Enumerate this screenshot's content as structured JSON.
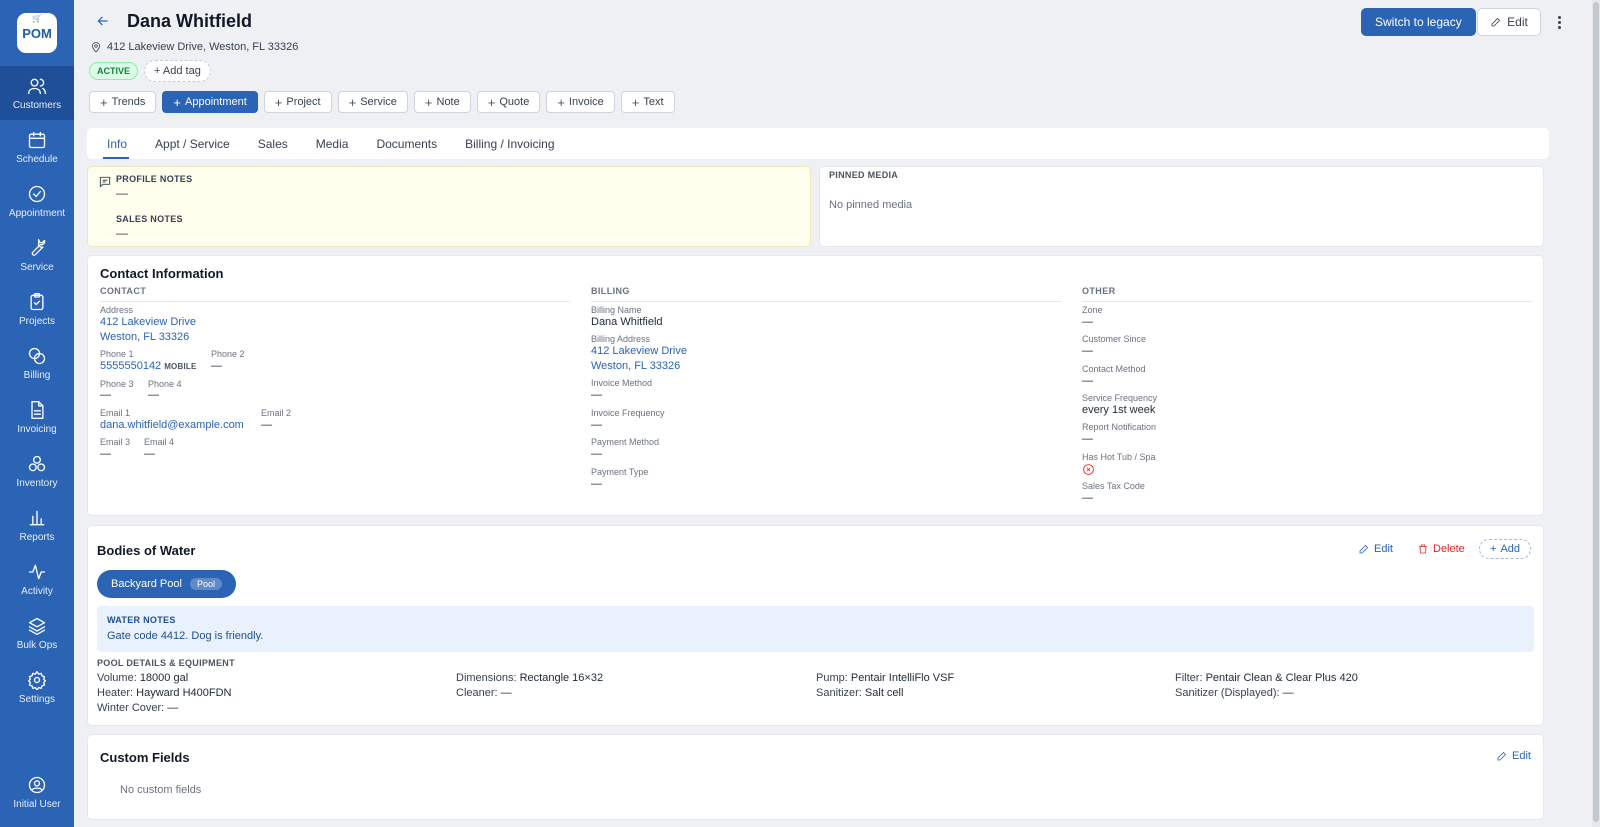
{
  "app": {
    "logo_text": "POM",
    "logo_icon": "cart-icon"
  },
  "sidebar": {
    "items": [
      {
        "label": "Customers",
        "icon": "users-icon",
        "active": true
      },
      {
        "label": "Schedule",
        "icon": "calendar-icon"
      },
      {
        "label": "Appointment",
        "icon": "check-circle-icon"
      },
      {
        "label": "Service",
        "icon": "wrench-icon"
      },
      {
        "label": "Projects",
        "icon": "clipboard-icon"
      },
      {
        "label": "Billing",
        "icon": "coins-icon"
      },
      {
        "label": "Invoicing",
        "icon": "document-icon"
      },
      {
        "label": "Inventory",
        "icon": "boxes-icon"
      },
      {
        "label": "Reports",
        "icon": "bar-chart-icon"
      },
      {
        "label": "Activity",
        "icon": "activity-icon"
      },
      {
        "label": "Bulk Ops",
        "icon": "layers-icon"
      },
      {
        "label": "Settings",
        "icon": "gear-icon"
      }
    ],
    "user": {
      "label": "Initial User",
      "icon": "user-circle-icon"
    }
  },
  "header": {
    "title": "Dana Whitfield",
    "address": "412 Lakeview Drive, Weston, FL 33326",
    "status": "ACTIVE",
    "add_tag": "+ Add tag",
    "switch_legacy": "Switch to legacy",
    "edit": "Edit"
  },
  "actions": [
    {
      "label": "Trends",
      "primary": false
    },
    {
      "label": "Appointment",
      "primary": true
    },
    {
      "label": "Project",
      "primary": false
    },
    {
      "label": "Service",
      "primary": false
    },
    {
      "label": "Note",
      "primary": false
    },
    {
      "label": "Quote",
      "primary": false
    },
    {
      "label": "Invoice",
      "primary": false
    },
    {
      "label": "Text",
      "primary": false
    }
  ],
  "tabs": [
    {
      "label": "Info",
      "active": true
    },
    {
      "label": "Appt / Service"
    },
    {
      "label": "Sales"
    },
    {
      "label": "Media"
    },
    {
      "label": "Documents"
    },
    {
      "label": "Billing / Invoicing"
    }
  ],
  "notes": {
    "profile_label": "PROFILE NOTES",
    "profile_value": "—",
    "sales_label": "SALES NOTES",
    "sales_value": "—"
  },
  "pinned": {
    "label": "PINNED MEDIA",
    "empty": "No pinned media"
  },
  "contact_info": {
    "title": "Contact Information",
    "contact": {
      "heading": "CONTACT",
      "address_label": "Address",
      "address_line1": "412 Lakeview Drive",
      "address_line2": "Weston, FL 33326",
      "phone1_label": "Phone 1",
      "phone1": "5555550142",
      "phone1_type": "MOBILE",
      "phone2_label": "Phone 2",
      "phone2": "—",
      "phone3_label": "Phone 3",
      "phone3": "—",
      "phone4_label": "Phone 4",
      "phone4": "—",
      "email1_label": "Email 1",
      "email1": "dana.whitfield@example.com",
      "email2_label": "Email 2",
      "email2": "—",
      "email3_label": "Email 3",
      "email3": "—",
      "email4_label": "Email 4",
      "email4": "—"
    },
    "billing": {
      "heading": "BILLING",
      "name_label": "Billing Name",
      "name": "Dana Whitfield",
      "address_label": "Billing Address",
      "address_line1": "412 Lakeview Drive",
      "address_line2": "Weston, FL 33326",
      "invoice_method_label": "Invoice Method",
      "invoice_method": "—",
      "invoice_freq_label": "Invoice Frequency",
      "invoice_freq": "—",
      "payment_method_label": "Payment Method",
      "payment_method": "—",
      "payment_type_label": "Payment Type",
      "payment_type": "—"
    },
    "other": {
      "heading": "OTHER",
      "zone_label": "Zone",
      "zone": "—",
      "since_label": "Customer Since",
      "since": "—",
      "contact_method_label": "Contact Method",
      "contact_method": "—",
      "service_freq_label": "Service Frequency",
      "service_freq": "every 1st week",
      "report_label": "Report Notification",
      "report": "—",
      "hot_tub_label": "Has Hot Tub / Spa",
      "tax_label": "Sales Tax Code",
      "tax": "—"
    }
  },
  "bodies_of_water": {
    "title": "Bodies of Water",
    "edit": "Edit",
    "delete": "Delete",
    "add": "Add",
    "pool_name": "Backyard Pool",
    "pool_type": "Pool",
    "notes_label": "WATER NOTES",
    "notes": "Gate code 4412. Dog is friendly.",
    "details_label": "POOL DETAILS & EQUIPMENT",
    "details": [
      {
        "label": "Volume:",
        "value": "18000 gal"
      },
      {
        "label": "Dimensions:",
        "value": "Rectangle 16×32"
      },
      {
        "label": "Pump:",
        "value": "Pentair IntelliFlo VSF"
      },
      {
        "label": "Filter:",
        "value": "Pentair Clean & Clear Plus 420"
      },
      {
        "label": "Heater:",
        "value": "Hayward H400FDN"
      },
      {
        "label": "Cleaner:",
        "value": "—"
      },
      {
        "label": "Sanitizer:",
        "value": "Salt cell"
      },
      {
        "label": "Sanitizer (Displayed):",
        "value": "—"
      },
      {
        "label": "Winter Cover:",
        "value": "—"
      }
    ]
  },
  "custom_fields": {
    "title": "Custom Fields",
    "edit": "Edit",
    "empty": "No custom fields"
  },
  "colors": {
    "accent": "#2b63b5",
    "sidebar": "#2b63b5",
    "danger": "#dc2626",
    "active_badge": "#15803d",
    "notes_bg": "#fffdeb"
  }
}
